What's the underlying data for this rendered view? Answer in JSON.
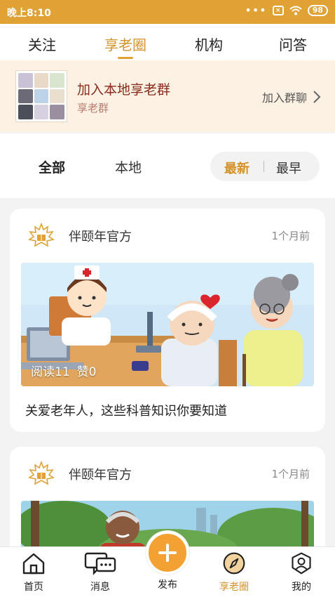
{
  "status_bar": {
    "time": "晚上8:10",
    "battery": "98"
  },
  "top_tabs": [
    {
      "label": "关注"
    },
    {
      "label": "享老圈"
    },
    {
      "label": "机构"
    },
    {
      "label": "问答"
    }
  ],
  "join_banner": {
    "title": "加入本地享老群",
    "subtitle": "享老群",
    "button": "加入群聊"
  },
  "filters": {
    "all": "全部",
    "local": "本地",
    "sort_newest": "最新",
    "sort_oldest": "最早"
  },
  "posts": [
    {
      "author": "伴颐年官方",
      "time_ago": "1个月前",
      "reads": "阅读11",
      "likes": "赞0",
      "title": "关爱老年人，这些科普知识你要知道"
    },
    {
      "author": "伴颐年官方",
      "time_ago": "1个月前"
    }
  ],
  "bottom_nav": {
    "home": "首页",
    "messages": "消息",
    "publish": "发布",
    "circle": "享老圈",
    "mine": "我的"
  },
  "colors": {
    "accent": "#e0a235",
    "active_text": "#d4922b",
    "banner_bg": "#fdf1e4",
    "banner_title": "#8a2c1d"
  }
}
